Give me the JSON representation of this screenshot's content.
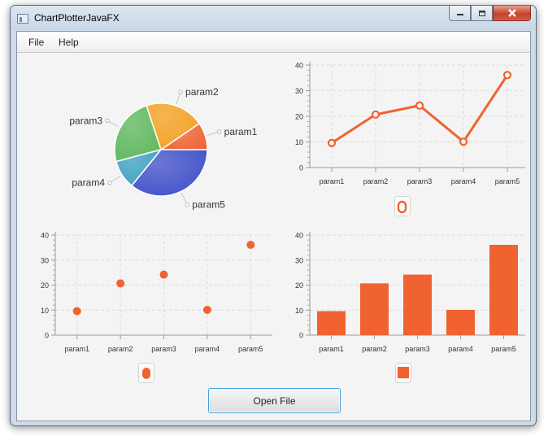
{
  "window": {
    "title": "ChartPlotterJavaFX"
  },
  "menu": [
    "File",
    "Help"
  ],
  "button": {
    "open_file": "Open File"
  },
  "colors": {
    "accent": "#f06230",
    "grid": "#dcdcdc",
    "axis": "#9a9a9a",
    "button_border": "#3ea3e2"
  },
  "chart_data": [
    {
      "type": "pie",
      "labels": [
        "param1",
        "param2",
        "param3",
        "param4",
        "param5"
      ],
      "values": [
        9.6,
        20.7,
        24.2,
        10.1,
        36.1
      ],
      "colors": [
        "#f06230",
        "#f4a01c",
        "#5cb85c",
        "#3a9fc2",
        "#3e4ec9"
      ]
    },
    {
      "type": "line",
      "categories": [
        "param1",
        "param2",
        "param3",
        "param4",
        "param5"
      ],
      "values": [
        9.6,
        20.7,
        24.2,
        10.1,
        36.1
      ],
      "ylim": [
        0,
        40
      ],
      "yticks": [
        0,
        10,
        20,
        30,
        40
      ],
      "legend_icon": "line-series-icon"
    },
    {
      "type": "scatter",
      "categories": [
        "param1",
        "param2",
        "param3",
        "param4",
        "param5"
      ],
      "values": [
        9.6,
        20.7,
        24.2,
        10.1,
        36.1
      ],
      "ylim": [
        0,
        40
      ],
      "yticks": [
        0,
        10,
        20,
        30,
        40
      ],
      "legend_icon": "scatter-series-icon"
    },
    {
      "type": "bar",
      "categories": [
        "param1",
        "param2",
        "param3",
        "param4",
        "param5"
      ],
      "values": [
        9.6,
        20.7,
        24.2,
        10.1,
        36.1
      ],
      "ylim": [
        0,
        40
      ],
      "yticks": [
        0,
        10,
        20,
        30,
        40
      ],
      "legend_icon": "bar-series-icon"
    }
  ]
}
